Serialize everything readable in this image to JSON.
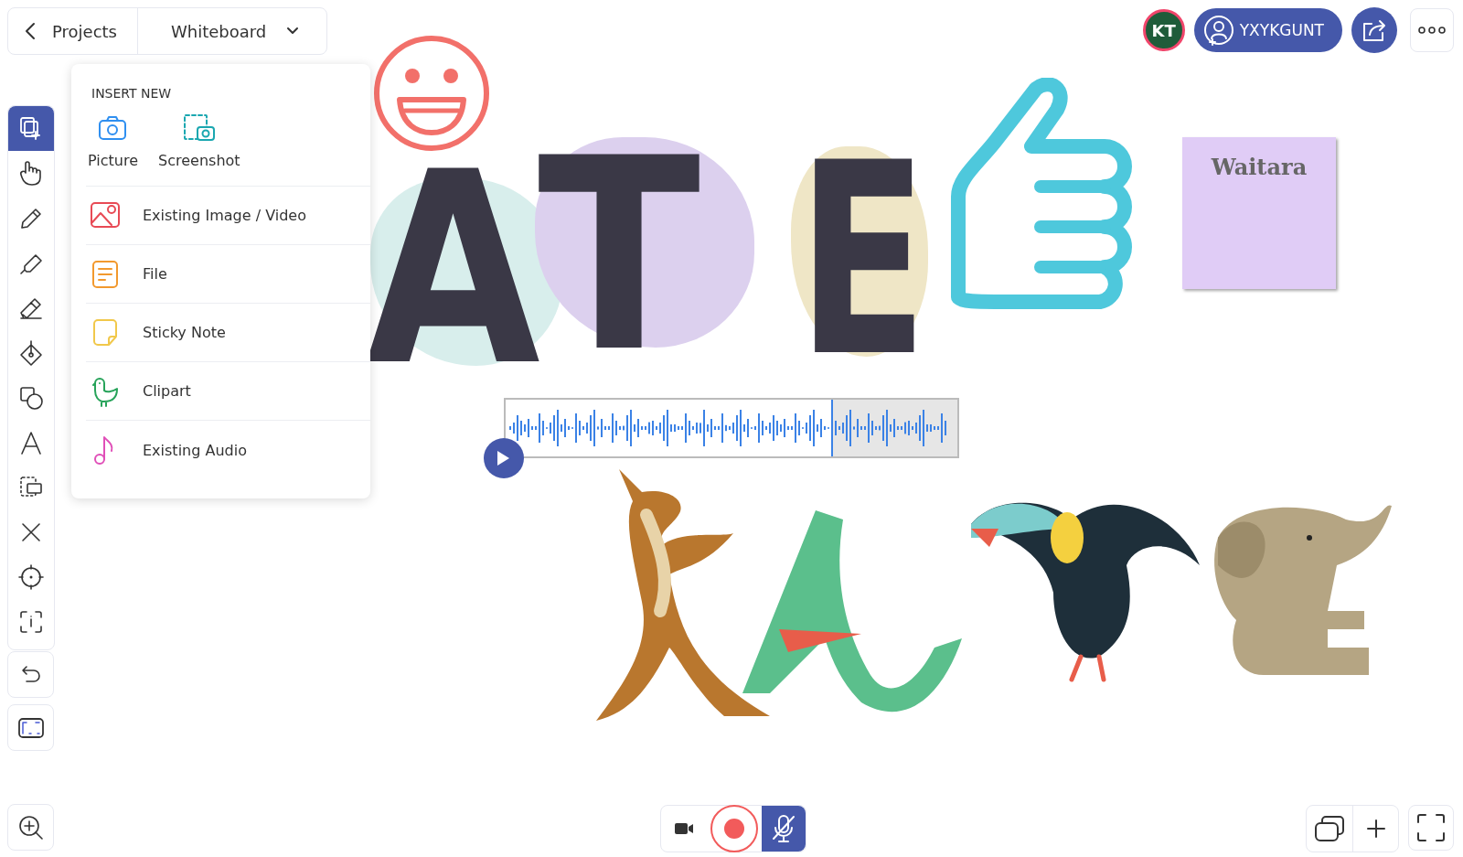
{
  "header": {
    "back_label": "Projects",
    "board_title": "Whiteboard"
  },
  "collaborators": {
    "avatar_initials": "KT",
    "invite_label": "YXYKGUNT"
  },
  "toolbar": {
    "tools": [
      {
        "selected": true
      },
      {
        "selected": false
      },
      {
        "selected": false
      },
      {
        "selected": false
      },
      {
        "selected": false
      },
      {
        "selected": false
      },
      {
        "selected": false
      },
      {
        "selected": false
      },
      {
        "selected": false
      },
      {
        "selected": false
      },
      {
        "selected": false
      },
      {
        "selected": false
      }
    ]
  },
  "insert_menu": {
    "heading": "INSERT NEW",
    "quick": [
      {
        "label": "Picture"
      },
      {
        "label": "Screenshot"
      }
    ],
    "items": [
      {
        "label": "Existing Image / Video"
      },
      {
        "label": "File"
      },
      {
        "label": "Sticky Note"
      },
      {
        "label": "Clipart"
      },
      {
        "label": "Existing Audio"
      }
    ]
  },
  "canvas": {
    "letters": [
      {
        "text": "A",
        "color": "#d8eeec"
      },
      {
        "text": "T",
        "color": "#dcd0ee"
      },
      {
        "text": "E",
        "color": "#efe6c6"
      }
    ],
    "sticky_note": {
      "text": "Waitara"
    },
    "audio": {
      "level": 0.72
    }
  },
  "recorder": {
    "mic_muted": true
  }
}
